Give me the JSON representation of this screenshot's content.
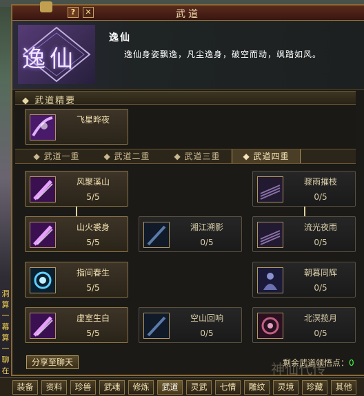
{
  "window": {
    "title": "武道",
    "help_label": "?",
    "close_label": "✕"
  },
  "header": {
    "emblem_text": "逸仙",
    "name": "逸仙",
    "description": "逸仙身姿飘逸，凡尘逸身，破空而动，飒踏如风。"
  },
  "essence": {
    "title": "武道精要",
    "skill": {
      "name": "飞星晔夜",
      "icon": "purple-dash-icon"
    }
  },
  "tabs": [
    {
      "label": "武道一重",
      "active": false
    },
    {
      "label": "武道二重",
      "active": false
    },
    {
      "label": "武道三重",
      "active": false
    },
    {
      "label": "武道四重",
      "active": true
    }
  ],
  "skills": [
    {
      "name": "风聚溪山",
      "count": "5/5",
      "icon": "purple-slash-icon",
      "active": true
    },
    {
      "name": "骤雨摧枝",
      "count": "0/5",
      "icon": "purple-streak-icon",
      "active": false
    },
    {
      "name": "山火裘身",
      "count": "5/5",
      "icon": "purple-slash-icon",
      "active": true
    },
    {
      "name": "湘江溯影",
      "count": "0/5",
      "icon": "blue-slash-icon",
      "active": false
    },
    {
      "name": "流光夜雨",
      "count": "0/5",
      "icon": "purple-streak-icon",
      "active": false
    },
    {
      "name": "指间春生",
      "count": "5/5",
      "icon": "blue-swirl-icon",
      "active": true
    },
    {
      "name": "朝暮同辉",
      "count": "0/5",
      "icon": "blue-figure-icon",
      "active": false
    },
    {
      "name": "虚室生白",
      "count": "5/5",
      "icon": "purple-slash-icon",
      "active": true
    },
    {
      "name": "空山回响",
      "count": "0/5",
      "icon": "blue-slash-icon",
      "active": false
    },
    {
      "name": "北溟揽月",
      "count": "0/5",
      "icon": "pink-swirl-icon",
      "active": false
    }
  ],
  "footer": {
    "share_label": "分享至聊天",
    "points_label": "剩余武道领悟点：",
    "points_value": "0",
    "watermark": "神仙代传"
  },
  "side_text": [
    "洞",
    "算",
    "一",
    "幕",
    "算",
    "一",
    "聊",
    "在",
    "发",
    "尔",
    "言"
  ],
  "bottom_nav": [
    "装备",
    "资料",
    "珍兽",
    "武魂",
    "修炼",
    "武道",
    "灵武",
    "七情",
    "雕纹",
    "灵境",
    "珍藏",
    "其他"
  ],
  "bottom_nav_active": "武道",
  "colors": {
    "accent": "#8a6a34",
    "points": "#4aff4a",
    "title_bar": "#5a2a1c"
  }
}
